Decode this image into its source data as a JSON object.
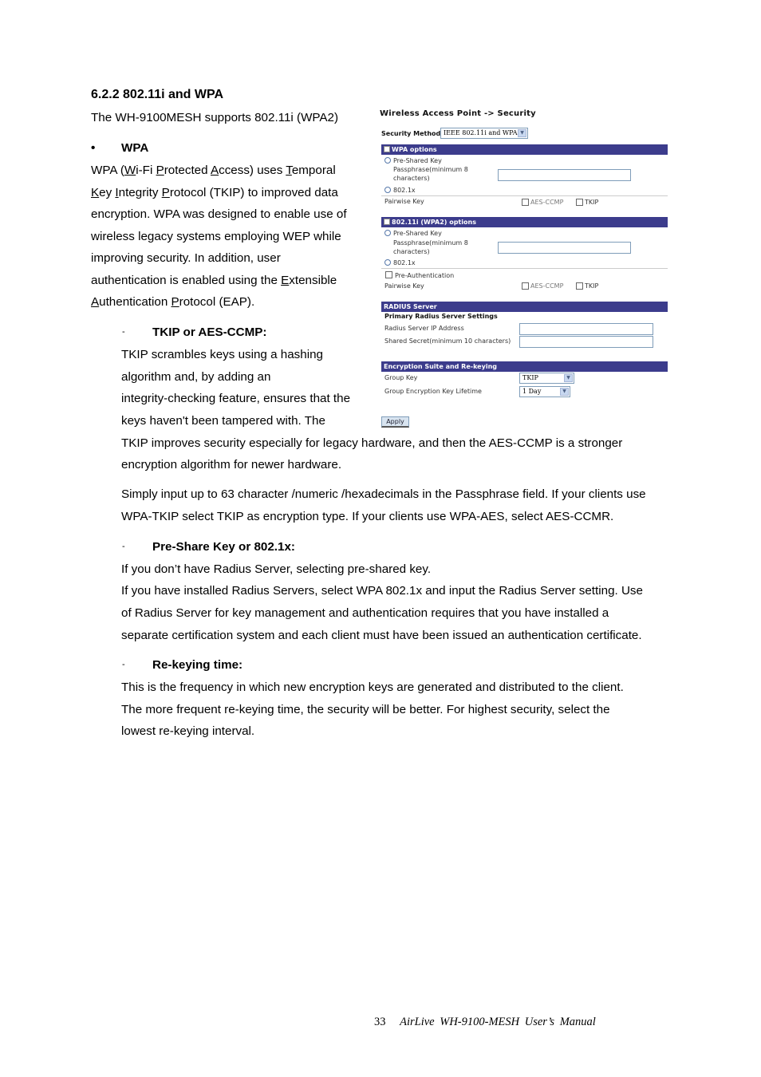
{
  "section": {
    "heading": "6.2.2 802.11i and WPA",
    "intro": "The WH-9100MESH supports 802.11i (WPA2)"
  },
  "wpa": {
    "bullet": "•",
    "heading": "WPA",
    "lines": [
      [
        "WPA (",
        "W",
        "i-Fi ",
        "P",
        "rotected ",
        "A",
        "ccess) uses ",
        "T",
        "emporal"
      ],
      [
        "",
        "K",
        "ey ",
        "I",
        "ntegrity ",
        "P",
        "rotocol (TKIP) to improved data"
      ],
      [
        "encryption. WPA was designed to enable use of"
      ],
      [
        "wireless legacy systems employing WEP while"
      ],
      [
        "improving security. In addition, user"
      ],
      [
        "authentication is enabled using the ",
        "E",
        "xtensible"
      ],
      [
        "",
        "A",
        "uthentication ",
        "P",
        "rotocol (EAP)."
      ]
    ]
  },
  "tkip": {
    "dash": "-",
    "heading": "TKIP or AES-CCMP:",
    "lines": [
      "TKIP scrambles keys using a hashing",
      "algorithm and, by adding an",
      "integrity-checking feature, ensures that the",
      "keys haven't been tampered with. The",
      "TKIP improves security especially for legacy hardware, and then the AES-CCMP is a stronger",
      "encryption algorithm for newer hardware."
    ],
    "para2": [
      "Simply input up to 63 character /numeric /hexadecimals in the Passphrase field. If your clients use",
      "WPA-TKIP select TKIP as encryption type. If your clients use WPA-AES, select AES-CCMR."
    ]
  },
  "psk": {
    "dash": "-",
    "heading": "Pre-Share Key or 802.1x:",
    "lines": [
      "If you don’t have Radius Server, selecting pre-shared key.",
      "If you have installed Radius Servers, select WPA 802.1x and input the Radius Server setting. Use",
      "of Radius Server for key management and authentication requires that you have installed a",
      "separate certification system and each client must have been issued an authentication certificate."
    ]
  },
  "rekey": {
    "dash": "-",
    "heading": "Re-keying time:",
    "lines": [
      "This is the frequency in which new encryption keys are generated and distributed to the client.",
      "The more frequent re-keying time, the security will be better. For highest security, select the",
      "lowest re-keying interval."
    ]
  },
  "ui": {
    "title": "Wireless Access Point -> Security",
    "security_method_label": "Security Method:",
    "security_method_value": "IEEE 802.11i and WPA",
    "wpa_options": {
      "header": "WPA options",
      "psk_label": "Pre-Shared Key",
      "passphrase_label_1": "Passphrase(minimum 8",
      "passphrase_label_2": "characters)",
      "dot1x_label": "802.1x",
      "pairwise_label": "Pairwise Key",
      "aes_label": "AES-CCMP",
      "tkip_label": "TKIP",
      "passphrase_value": ""
    },
    "wpa2_options": {
      "header": "802.11i (WPA2) options",
      "psk_label": "Pre-Shared Key",
      "passphrase_label_1": "Passphrase(minimum 8",
      "passphrase_label_2": "characters)",
      "dot1x_label": "802.1x",
      "preauth_label": "Pre-Authentication",
      "pairwise_label": "Pairwise Key",
      "aes_label": "AES-CCMP",
      "tkip_label": "TKIP",
      "passphrase_value": ""
    },
    "radius": {
      "header": "RADIUS Server",
      "subheader": "Primary Radius Server Settings",
      "ip_label": "Radius Server IP Address",
      "secret_label": "Shared Secret(minimum 10 characters)",
      "ip_value": "",
      "secret_value": ""
    },
    "encryption": {
      "header": "Encryption Suite and Re-keying",
      "group_key_label": "Group Key",
      "group_key_value": "TKIP",
      "lifetime_label": "Group Encryption Key Lifetime",
      "lifetime_value": "1 Day"
    },
    "apply_label": "Apply",
    "dropdown_glyph": "▼"
  },
  "footer": {
    "page_number": "33",
    "manual_title": "AirLive WH-9100-MESH User’s Manual"
  }
}
